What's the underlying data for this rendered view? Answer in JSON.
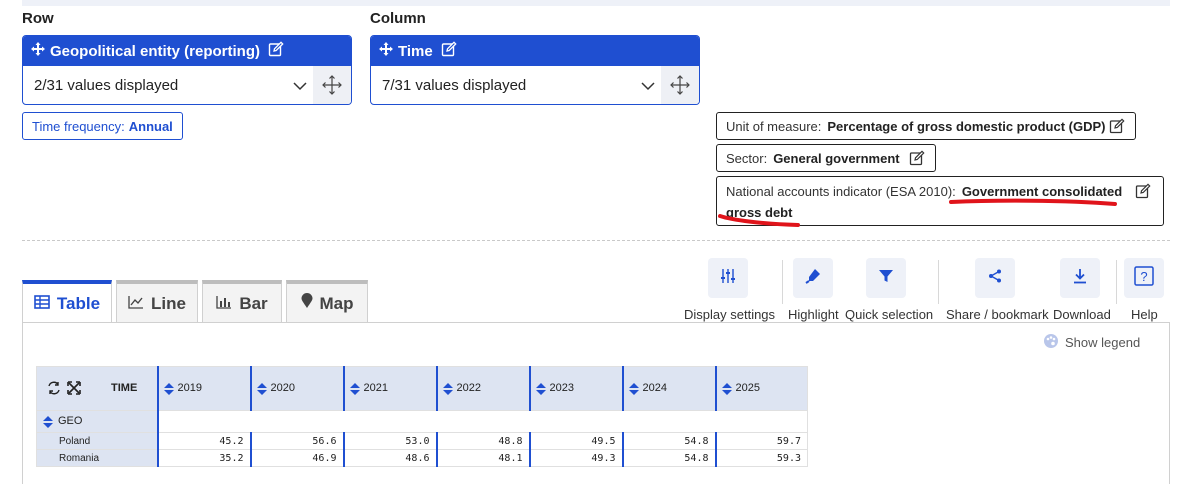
{
  "layout": {
    "row_label": "Row",
    "column_label": "Column"
  },
  "row_dimension": {
    "title": "Geopolitical entity (reporting)",
    "value": "2/31 values displayed"
  },
  "column_dimension": {
    "title": "Time",
    "value": "7/31 values displayed"
  },
  "time_frequency": {
    "label": "Time frequency:",
    "value": "Annual"
  },
  "filters": [
    {
      "label": "Unit of measure:",
      "value": "Percentage of gross domestic product (GDP)"
    },
    {
      "label": "Sector:",
      "value": "General government"
    },
    {
      "label": "National accounts indicator (ESA 2010):",
      "value": "Government consolidated",
      "value_line2": "gross debt"
    }
  ],
  "tabs": [
    {
      "label": "Table",
      "icon": "table-icon",
      "active": true
    },
    {
      "label": "Line",
      "icon": "line-chart-icon",
      "active": false
    },
    {
      "label": "Bar",
      "icon": "bar-chart-icon",
      "active": false
    },
    {
      "label": "Map",
      "icon": "map-pin-icon",
      "active": false
    }
  ],
  "toolbar": [
    {
      "label": "Display settings",
      "icon": "sliders-icon"
    },
    {
      "label": "Highlight",
      "icon": "highlighter-icon"
    },
    {
      "label": "Quick selection",
      "icon": "filter-icon"
    },
    {
      "label": "Share / bookmark",
      "icon": "share-icon"
    },
    {
      "label": "Download",
      "icon": "download-icon"
    },
    {
      "label": "Help",
      "icon": "help-icon"
    }
  ],
  "show_legend": "Show legend",
  "table": {
    "time_header": "TIME",
    "geo_header": "GEO",
    "years": [
      "2019",
      "2020",
      "2021",
      "2022",
      "2023",
      "2024",
      "2025"
    ],
    "rows": [
      {
        "geo": "Poland",
        "values": [
          "45.2",
          "56.6",
          "53.0",
          "48.8",
          "49.5",
          "54.8",
          "59.7"
        ]
      },
      {
        "geo": "Romania",
        "values": [
          "35.2",
          "46.9",
          "48.6",
          "48.1",
          "49.3",
          "54.8",
          "59.3"
        ]
      }
    ]
  },
  "colors": {
    "accent": "#1f4fd1",
    "annotation": "#e0141b",
    "table_header_bg": "#dde4f2"
  }
}
